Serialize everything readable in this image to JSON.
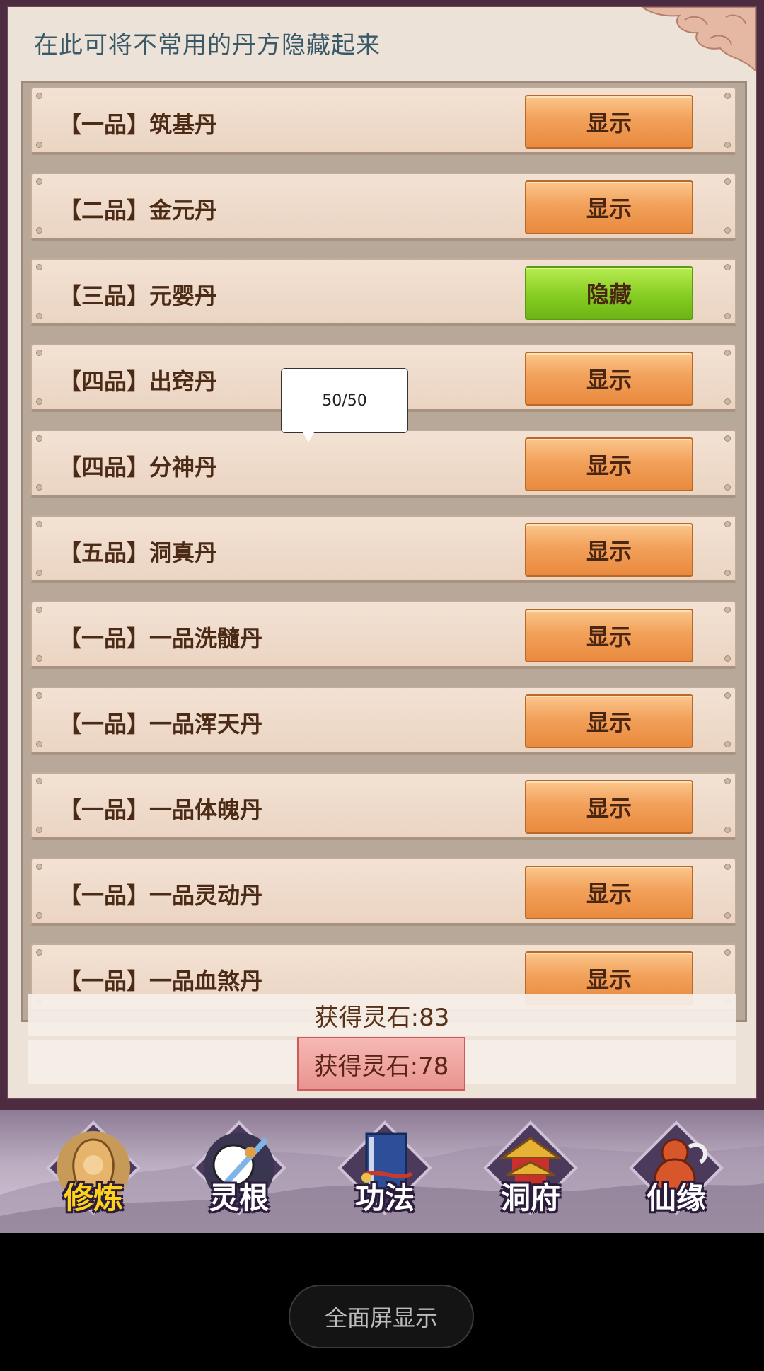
{
  "panel": {
    "title": "在此可将不常用的丹方隐藏起来"
  },
  "recipes": [
    {
      "label": "【一品】筑基丹",
      "button": "显示",
      "state": "orange"
    },
    {
      "label": "【二品】金元丹",
      "button": "显示",
      "state": "orange"
    },
    {
      "label": "【三品】元婴丹",
      "button": "隐藏",
      "state": "green"
    },
    {
      "label": "【四品】出窍丹",
      "button": "显示",
      "state": "orange"
    },
    {
      "label": "【四品】分神丹",
      "button": "显示",
      "state": "orange"
    },
    {
      "label": "【五品】洞真丹",
      "button": "显示",
      "state": "orange"
    },
    {
      "label": "【一品】一品洗髓丹",
      "button": "显示",
      "state": "orange"
    },
    {
      "label": "【一品】一品浑天丹",
      "button": "显示",
      "state": "orange"
    },
    {
      "label": "【一品】一品体魄丹",
      "button": "显示",
      "state": "orange"
    },
    {
      "label": "【一品】一品灵动丹",
      "button": "显示",
      "state": "orange"
    },
    {
      "label": "【一品】一品血煞丹",
      "button": "显示",
      "state": "orange"
    }
  ],
  "tooltip": {
    "text": "50/50"
  },
  "toasts": {
    "first": "获得灵石:83",
    "second": "获得灵石:78"
  },
  "bottom_nav": [
    {
      "label": "修炼",
      "icon": "cultivation-monk-icon",
      "active": true
    },
    {
      "label": "灵根",
      "icon": "spirit-root-sword-icon",
      "active": false
    },
    {
      "label": "功法",
      "icon": "technique-book-icon",
      "active": false
    },
    {
      "label": "洞府",
      "icon": "cave-pagoda-icon",
      "active": false
    },
    {
      "label": "仙缘",
      "icon": "gourd-icon",
      "active": false
    }
  ],
  "system": {
    "fullscreen_label": "全面屏显示"
  },
  "colors": {
    "button_orange": "#f2a15b",
    "button_green": "#86cd22",
    "title_text": "#3a5968",
    "label_text": "#4b2a16",
    "nav_active": "#ffd21a"
  }
}
